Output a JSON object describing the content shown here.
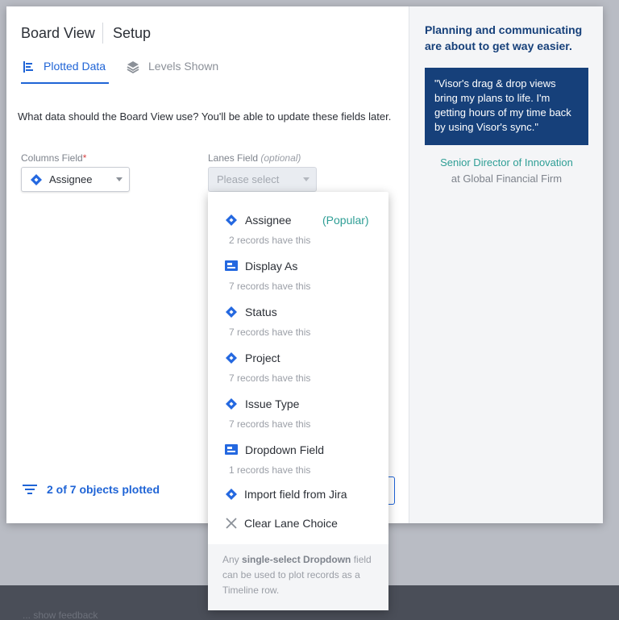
{
  "background_text": "... show feedback",
  "header": {
    "title": "Board View",
    "subtitle": "Setup"
  },
  "tabs": [
    {
      "label": "Plotted Data",
      "icon": "plot-icon",
      "active": true
    },
    {
      "label": "Levels Shown",
      "icon": "layers-icon",
      "active": false
    }
  ],
  "question": "What data should the Board View use? You'll be able to update these fields later.",
  "columns_field": {
    "label": "Columns Field",
    "required_mark": "*",
    "value": "Assignee",
    "icon": "jira-diamond-icon"
  },
  "lanes_field": {
    "label": "Lanes Field",
    "optional_text": "(optional)",
    "placeholder": "Please select"
  },
  "footer": {
    "plotted_text": "2 of 7 objects plotted"
  },
  "aside": {
    "headline": "Planning and communicating are about to get way easier.",
    "quote": "\"Visor's drag & drop views bring my plans to life. I'm getting hours of my time back by using Visor's sync.\"",
    "author": "Senior Director of Innovation",
    "company": "at Global Financial Firm"
  },
  "dropdown": {
    "options": [
      {
        "name": "Assignee",
        "badge": "(Popular)",
        "meta": "2 records have this",
        "icon": "jira-diamond-icon"
      },
      {
        "name": "Display As",
        "badge": "",
        "meta": "7 records have this",
        "icon": "visor-field-icon"
      },
      {
        "name": "Status",
        "badge": "",
        "meta": "7 records have this",
        "icon": "jira-diamond-icon"
      },
      {
        "name": "Project",
        "badge": "",
        "meta": "7 records have this",
        "icon": "jira-diamond-icon"
      },
      {
        "name": "Issue Type",
        "badge": "",
        "meta": "7 records have this",
        "icon": "jira-diamond-icon"
      },
      {
        "name": "Dropdown Field",
        "badge": "",
        "meta": "1 records have this",
        "icon": "visor-field-icon"
      }
    ],
    "import_label": "Import field from Jira",
    "clear_label": "Clear Lane Choice",
    "footer_prefix": "Any ",
    "footer_bold": "single-select Dropdown",
    "footer_suffix": " field can be used to plot records as a Timeline row."
  },
  "colors": {
    "accent": "#1f64d6",
    "brand_navy": "#16407a",
    "teal": "#2e9e95"
  }
}
